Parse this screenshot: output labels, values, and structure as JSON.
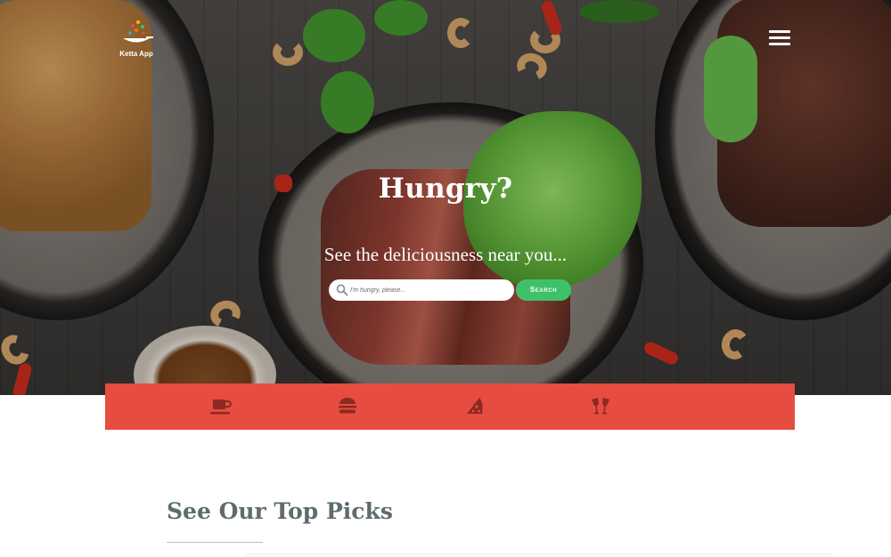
{
  "brand": {
    "name": "Ketta App"
  },
  "header": {
    "menu_icon": "hamburger-menu-icon"
  },
  "hero": {
    "title": "Hungry?",
    "subtitle": "See the deliciousness near you...",
    "search": {
      "placeholder": "I'm hungry, please...",
      "value": "",
      "button_label": "Search"
    }
  },
  "categories": [
    {
      "name": "coffee",
      "icon": "coffee-cup-icon"
    },
    {
      "name": "burger",
      "icon": "burger-icon"
    },
    {
      "name": "pizza",
      "icon": "pizza-slice-icon"
    },
    {
      "name": "drinks",
      "icon": "toast-glasses-icon"
    }
  ],
  "section": {
    "title": "See Our Top Picks"
  },
  "colors": {
    "accent": "#e64c3f",
    "search_button": "#3fc169",
    "section_title": "#5e6b6f"
  }
}
